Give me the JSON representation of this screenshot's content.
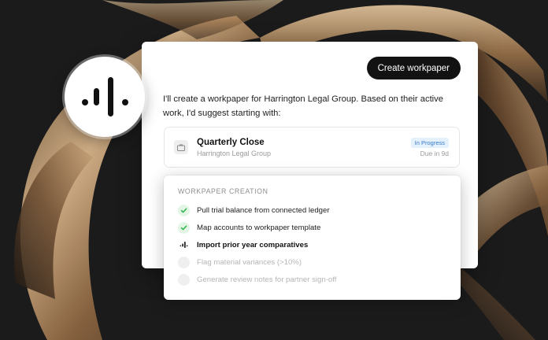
{
  "header": {
    "create_button_label": "Create workpaper"
  },
  "message": {
    "intro": "I'll create a workpaper for Harrington Legal Group. Based on their active work, I'd suggest starting with:"
  },
  "task": {
    "icon": "briefcase-icon",
    "title": "Quarterly Close",
    "subtitle": "Harrington Legal Group",
    "status": "In Progress",
    "due": "Due in 9d"
  },
  "workpaper": {
    "header": "WORKPAPER CREATION",
    "steps": [
      {
        "label": "Pull trial balance from connected ledger",
        "state": "done",
        "icon": "check-icon"
      },
      {
        "label": "Map accounts to workpaper template",
        "state": "done",
        "icon": "check-icon"
      },
      {
        "label": "Import prior year comparatives",
        "state": "active",
        "icon": "loading-bars-icon"
      },
      {
        "label": "Flag material variances (>10%)",
        "state": "pending",
        "icon": "pending-circle-icon"
      },
      {
        "label": "Generate review notes for partner sign-off",
        "state": "pending",
        "icon": "pending-circle-icon"
      }
    ]
  },
  "colors": {
    "background": "#1b1b1b",
    "button": "#121212",
    "badge_bg": "#e4f0fb",
    "badge_text": "#3b7cc9",
    "check": "#2fb34a",
    "bronze": "#a8825a"
  },
  "logo": {
    "icon": "audio-bars-logo-icon"
  }
}
